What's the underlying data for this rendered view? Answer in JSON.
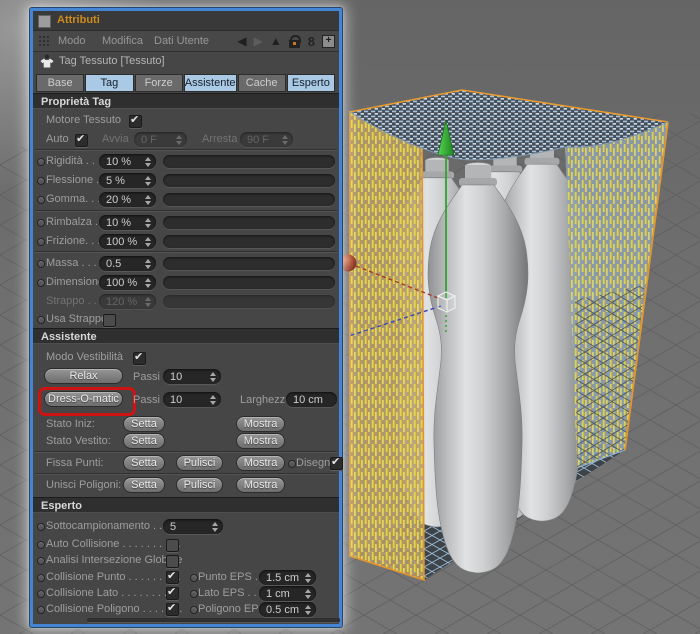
{
  "window": {
    "title": "Attributi"
  },
  "menubar": {
    "items": [
      "Modo",
      "Modifica",
      "Dati Utente"
    ],
    "icons": {
      "back": "◀",
      "forward": "▶",
      "up": "▲",
      "link": "8",
      "add": "+"
    }
  },
  "object_header": {
    "label": "Tag Tessuto [Tessuto]"
  },
  "tabs": [
    {
      "label": "Base",
      "active": false
    },
    {
      "label": "Tag",
      "active": true
    },
    {
      "label": "Forze",
      "active": false
    },
    {
      "label": "Assistente",
      "active": true
    },
    {
      "label": "Cache",
      "active": false
    },
    {
      "label": "Esperto",
      "active": true
    }
  ],
  "proprieta": {
    "title": "Proprietà Tag",
    "motore_label": "Motore Tessuto",
    "auto_label": "Auto",
    "avvia_label": "Avvia",
    "avvia_value": "0 F",
    "arresta_label": "Arresta",
    "arresta_value": "90 F",
    "group1": [
      {
        "label": "Rigidità . . . .",
        "value": "10 %"
      },
      {
        "label": "Flessione . .",
        "value": "5 %"
      },
      {
        "label": "Gomma. . . .",
        "value": "20 %"
      }
    ],
    "group2": [
      {
        "label": "Rimbalza . .",
        "value": "10 %"
      },
      {
        "label": "Frizione. . . .",
        "value": "100 %"
      }
    ],
    "group3": [
      {
        "label": "Massa . . . .",
        "value": "0.5"
      },
      {
        "label": "Dimensione",
        "value": "100 %"
      },
      {
        "label": "Strappo . . .",
        "value": "120 %"
      }
    ],
    "usa_strappo_label": "Usa Strappo"
  },
  "assistente": {
    "title": "Assistente",
    "modo_vestibilita_label": "Modo Vestibilità",
    "relax_button": "Relax",
    "passi_label": "Passi",
    "relax_passi_value": "10",
    "dress_button": "Dress-O-matic",
    "dress_passi_value": "10",
    "larghezza_label": "Larghezza",
    "larghezza_value": "10 cm",
    "stato_iniz_label": "Stato Iniz:",
    "stato_vestito_label": "Stato Vestito:",
    "fissa_label": "Fissa Punti:",
    "unisci_label": "Unisci Poligoni:",
    "setta": "Setta",
    "pulisci": "Pulisci",
    "mostra": "Mostra",
    "disegna_label": "Disegna"
  },
  "esperto": {
    "title": "Esperto",
    "sotto_label": "Sottocampionamento . . . . .",
    "sotto_value": "5",
    "auto_collisione_label": "Auto Collisione . . . . . . . . . .",
    "analisi_label": "Analisi Intersezione Globale",
    "rows": [
      {
        "label": "Collisione Punto . . . . . . . . .",
        "eps_label": "Punto EPS . .",
        "eps_value": "1.5 cm"
      },
      {
        "label": "Collisione Lato . . . . . . . . . .",
        "eps_label": "Lato EPS . . .",
        "eps_value": "1 cm"
      },
      {
        "label": "Collisione Poligono . . . . . . .",
        "eps_label": "Poligono EPS",
        "eps_value": "0.5 cm"
      }
    ]
  },
  "colors": {
    "panel_border_blue": "#4484d4",
    "tab_active_blue": "#a9c9e5",
    "title_orange": "#cd8a1d",
    "highlight_red": "#cf1212",
    "cube_edge_orange": "#e2952f",
    "cloth_yellow": "#e9de3b",
    "axis_green": "#2da52d",
    "axis_red_handle": "#a83828",
    "axis_blue": "#3848b8"
  }
}
